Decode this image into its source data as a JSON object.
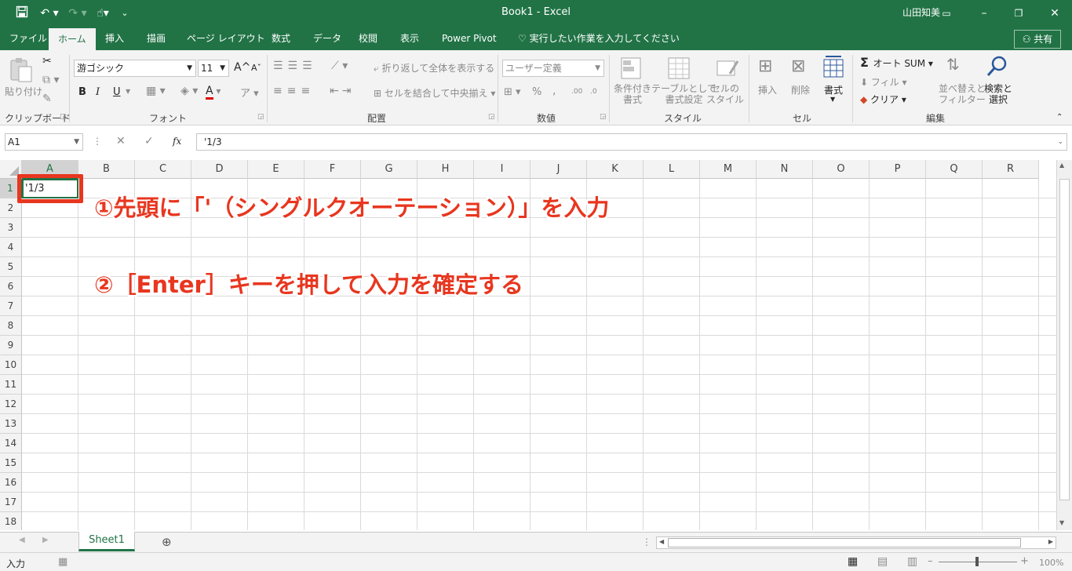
{
  "window": {
    "title": "Book1  -  Excel",
    "user": "山田知美",
    "share": "共有"
  },
  "tabs": [
    "ファイル",
    "ホーム",
    "挿入",
    "描画",
    "ページ レイアウト",
    "数式",
    "データ",
    "校閲",
    "表示",
    "Power Pivot"
  ],
  "active_tab": "ホーム",
  "tell_me": "実行したい作業を入力してください",
  "ribbon": {
    "clipboard": {
      "paste": "貼り付け",
      "label": "クリップボード"
    },
    "font": {
      "name": "游ゴシック",
      "size": "11",
      "label": "フォント",
      "bold": "B",
      "italic": "I",
      "underline": "U",
      "grow": "A",
      "shrink": "A",
      "color": "A"
    },
    "alignment": {
      "wrap": "折り返して全体を表示する",
      "merge": "セルを結合して中央揃え",
      "label": "配置"
    },
    "number": {
      "format": "ユーザー定義",
      "percent": "%",
      "comma": ",",
      "inc": ".00",
      "dec": ".0",
      "label": "数値"
    },
    "styles": {
      "cond1": "条件付き",
      "cond2": "書式",
      "table1": "テーブルとして",
      "table2": "書式設定",
      "cell1": "セルの",
      "cell2": "スタイル",
      "label": "スタイル"
    },
    "cells": {
      "insert": "挿入",
      "delete": "削除",
      "format": "書式",
      "label": "セル"
    },
    "editing": {
      "autosum": "オート SUM",
      "fill": "フィル",
      "clear": "クリア",
      "sort1": "並べ替えと",
      "sort2": "フィルター",
      "find1": "検索と",
      "find2": "選択",
      "label": "編集"
    }
  },
  "formula_bar": {
    "name_box": "A1",
    "fx": "fx",
    "formula": "'1/3"
  },
  "columns": [
    "A",
    "B",
    "C",
    "D",
    "E",
    "F",
    "G",
    "H",
    "I",
    "J",
    "K",
    "L",
    "M",
    "N",
    "O",
    "P",
    "Q",
    "R"
  ],
  "rows": [
    "1",
    "2",
    "3",
    "4",
    "5",
    "6",
    "7",
    "8",
    "9",
    "10",
    "11",
    "12",
    "13",
    "14",
    "15",
    "16",
    "17",
    "18"
  ],
  "active_cell": {
    "ref": "A1",
    "value": "'1/3"
  },
  "annotations": {
    "step1": "①先頭に「'（シングルクオーテーション）」を入力",
    "step2": "②［Enter］キーを押して入力を確定する"
  },
  "sheet_tab": "Sheet1",
  "status": {
    "mode": "入力",
    "zoom": "100%"
  },
  "colors": {
    "accent": "#217346",
    "annotation": "#e8361f"
  }
}
